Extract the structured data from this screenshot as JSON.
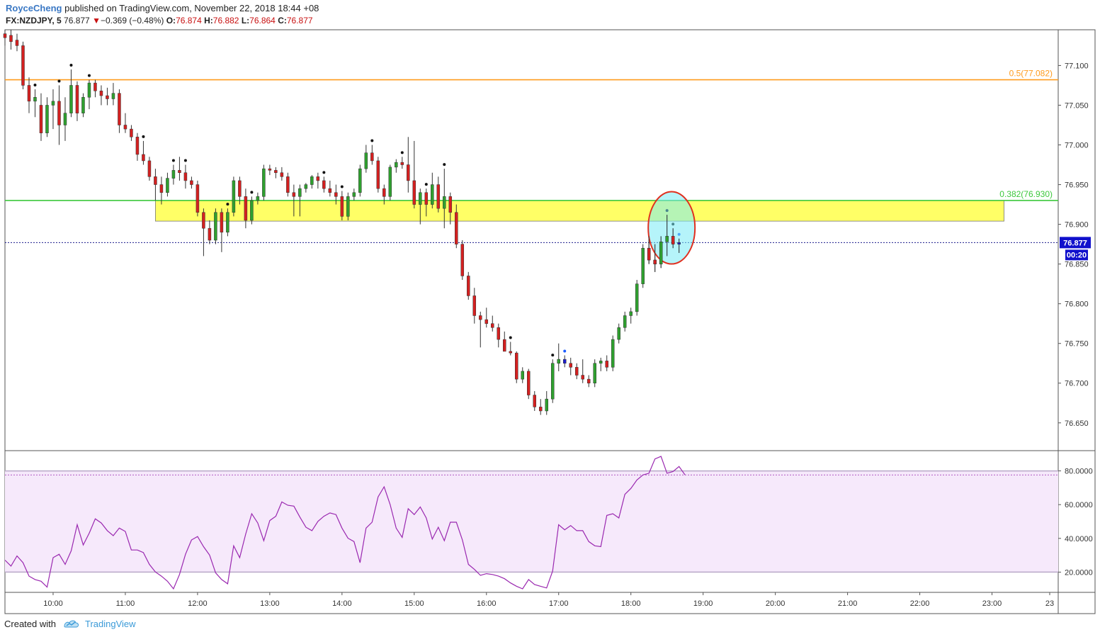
{
  "header": {
    "author": "RoyceCheng",
    "published": "published on TradingView.com, November 22, 2018 18:44 +08",
    "symbol": "FX:NZDJPY, 5",
    "last": "76.877",
    "change": "−0.369 (−0.48%)",
    "o_label": "O:",
    "o": "76.874",
    "h_label": "H:",
    "h": "76.882",
    "l_label": "L:",
    "l": "76.864",
    "c_label": "C:",
    "c": "76.877"
  },
  "footer": {
    "created": "Created with",
    "brand": "TradingView"
  },
  "colors": {
    "up": "#2fa02f",
    "down": "#d42020",
    "mark": "#1c1ccc",
    "fib50": "#ff9b1c",
    "fib382": "#3cc83c",
    "zone": "#ffff66",
    "rsi": "#9a28b0",
    "rsi_band": "#f6e9fb",
    "price_tag": "#1010cc"
  },
  "chart_data": [
    {
      "type": "candlestick",
      "symbol": "FX:NZDJPY",
      "interval": "5",
      "ylim": [
        76.615,
        77.145
      ],
      "xlim": [
        "09:20",
        "23:55"
      ],
      "y_ticks": [
        "77.100",
        "77.050",
        "77.000",
        "76.950",
        "76.900",
        "76.850",
        "76.800",
        "76.750",
        "76.700",
        "76.650"
      ],
      "x_ticks": [
        "10:00",
        "11:00",
        "12:00",
        "13:00",
        "14:00",
        "15:00",
        "16:00",
        "17:00",
        "18:00",
        "19:00",
        "20:00",
        "21:00",
        "22:00",
        "23:00",
        "23"
      ],
      "levels": [
        {
          "label": "0.5(77.082)",
          "value": 77.082,
          "color": "#ff9b1c"
        },
        {
          "label": "0.382(76.930)",
          "value": 76.93,
          "color": "#3cc83c"
        }
      ],
      "zone": {
        "from": 76.904,
        "to": 76.93,
        "start": "11:25",
        "end": "23:10"
      },
      "highlight": {
        "time": "18:35",
        "center": 76.892
      },
      "last_price": {
        "value": 76.877,
        "label": "76.877",
        "countdown": "00:20"
      },
      "candles": [
        [
          77.14,
          77.145,
          77.125,
          77.135
        ],
        [
          77.138,
          77.145,
          77.12,
          77.13
        ],
        [
          77.132,
          77.14,
          77.118,
          77.125
        ],
        [
          77.125,
          77.13,
          77.07,
          77.075
        ],
        [
          77.075,
          77.085,
          77.04,
          77.055
        ],
        [
          77.055,
          77.07,
          77.035,
          77.06
        ],
        [
          77.05,
          77.065,
          77.005,
          77.015
        ],
        [
          77.015,
          77.06,
          77.01,
          77.05
        ],
        [
          77.05,
          77.07,
          77.02,
          77.055
        ],
        [
          77.055,
          77.075,
          77.0,
          77.025
        ],
        [
          77.025,
          77.06,
          77.005,
          77.04
        ],
        [
          77.04,
          77.095,
          77.035,
          77.075
        ],
        [
          77.075,
          77.08,
          77.03,
          77.04
        ],
        [
          77.04,
          77.065,
          77.035,
          77.06
        ],
        [
          77.06,
          77.082,
          77.045,
          77.078
        ],
        [
          77.078,
          77.082,
          77.06,
          77.068
        ],
        [
          77.068,
          77.075,
          77.05,
          77.062
        ],
        [
          77.062,
          77.072,
          77.05,
          77.058
        ],
        [
          77.058,
          77.078,
          77.05,
          77.065
        ],
        [
          77.065,
          77.07,
          77.015,
          77.025
        ],
        [
          77.025,
          77.04,
          77.015,
          77.02
        ],
        [
          77.02,
          77.025,
          77.005,
          77.01
        ],
        [
          77.01,
          77.015,
          76.98,
          76.988
        ],
        [
          76.988,
          77.005,
          76.975,
          76.98
        ],
        [
          76.98,
          76.985,
          76.955,
          76.96
        ],
        [
          76.96,
          76.97,
          76.93,
          76.95
        ],
        [
          76.95,
          76.96,
          76.925,
          76.94
        ],
        [
          76.94,
          76.965,
          76.935,
          76.958
        ],
        [
          76.958,
          76.975,
          76.95,
          76.968
        ],
        [
          76.968,
          76.985,
          76.955,
          76.965
        ],
        [
          76.965,
          76.975,
          76.945,
          76.955
        ],
        [
          76.955,
          76.96,
          76.945,
          76.95
        ],
        [
          76.95,
          76.955,
          76.91,
          76.915
        ],
        [
          76.915,
          76.92,
          76.86,
          76.895
        ],
        [
          76.895,
          76.905,
          76.875,
          76.88
        ],
        [
          76.88,
          76.92,
          76.875,
          76.915
        ],
        [
          76.915,
          76.92,
          76.865,
          76.89
        ],
        [
          76.89,
          76.92,
          76.885,
          76.915
        ],
        [
          76.915,
          76.96,
          76.91,
          76.955
        ],
        [
          76.955,
          76.96,
          76.925,
          76.935
        ],
        [
          76.935,
          76.945,
          76.895,
          76.905
        ],
        [
          76.905,
          76.935,
          76.9,
          76.93
        ],
        [
          76.93,
          76.94,
          76.925,
          76.935
        ],
        [
          76.935,
          76.975,
          76.93,
          76.97
        ],
        [
          76.97,
          76.975,
          76.962,
          76.968
        ],
        [
          76.968,
          76.972,
          76.958,
          76.965
        ],
        [
          76.965,
          76.972,
          76.955,
          76.96
        ],
        [
          76.96,
          76.965,
          76.935,
          76.94
        ],
        [
          76.94,
          76.95,
          76.91,
          76.935
        ],
        [
          76.935,
          76.95,
          76.91,
          76.945
        ],
        [
          76.945,
          76.952,
          76.94,
          76.95
        ],
        [
          76.95,
          76.962,
          76.945,
          76.96
        ],
        [
          76.96,
          76.965,
          76.945,
          76.955
        ],
        [
          76.955,
          76.96,
          76.94,
          76.945
        ],
        [
          76.945,
          76.955,
          76.935,
          76.94
        ],
        [
          76.94,
          76.95,
          76.925,
          76.935
        ],
        [
          76.935,
          76.942,
          76.905,
          76.91
        ],
        [
          76.91,
          76.94,
          76.905,
          76.935
        ],
        [
          76.935,
          76.945,
          76.93,
          76.94
        ],
        [
          76.94,
          76.975,
          76.935,
          76.97
        ],
        [
          76.97,
          77.0,
          76.965,
          76.99
        ],
        [
          76.99,
          77.0,
          76.975,
          76.98
        ],
        [
          76.98,
          76.985,
          76.94,
          76.945
        ],
        [
          76.945,
          76.95,
          76.925,
          76.935
        ],
        [
          76.935,
          76.975,
          76.93,
          76.972
        ],
        [
          76.972,
          76.982,
          76.965,
          76.978
        ],
        [
          76.978,
          76.985,
          76.97,
          76.975
        ],
        [
          76.975,
          77.01,
          76.94,
          76.955
        ],
        [
          76.955,
          77.005,
          76.92,
          76.925
        ],
        [
          76.925,
          76.945,
          76.9,
          76.94
        ],
        [
          76.94,
          76.945,
          76.91,
          76.925
        ],
        [
          76.925,
          76.965,
          76.92,
          76.95
        ],
        [
          76.95,
          76.96,
          76.915,
          76.92
        ],
        [
          76.92,
          76.97,
          76.895,
          76.935
        ],
        [
          76.935,
          76.94,
          76.9,
          76.915
        ],
        [
          76.915,
          76.925,
          76.87,
          76.875
        ],
        [
          76.875,
          76.88,
          76.83,
          76.835
        ],
        [
          76.835,
          76.84,
          76.805,
          76.81
        ],
        [
          76.81,
          76.82,
          76.775,
          76.785
        ],
        [
          76.785,
          76.79,
          76.745,
          76.78
        ],
        [
          76.78,
          76.795,
          76.77,
          76.775
        ],
        [
          76.775,
          76.785,
          76.765,
          76.77
        ],
        [
          76.77,
          76.775,
          76.745,
          76.755
        ],
        [
          76.755,
          76.765,
          76.745,
          76.74
        ],
        [
          76.74,
          76.752,
          76.735,
          76.738
        ],
        [
          76.738,
          76.74,
          76.7,
          76.705
        ],
        [
          76.705,
          76.72,
          76.7,
          76.715
        ],
        [
          76.715,
          76.718,
          76.68,
          76.685
        ],
        [
          76.685,
          76.69,
          76.665,
          76.67
        ],
        [
          76.67,
          76.68,
          76.66,
          76.665
        ],
        [
          76.665,
          76.69,
          76.66,
          76.68
        ],
        [
          76.68,
          76.73,
          76.675,
          76.725
        ],
        [
          76.725,
          76.75,
          76.715,
          76.73
        ],
        [
          76.73,
          76.735,
          76.72,
          76.725
        ],
        [
          76.725,
          76.732,
          76.71,
          76.72
        ],
        [
          76.72,
          76.725,
          76.705,
          76.71
        ],
        [
          76.71,
          76.73,
          76.7,
          76.705
        ],
        [
          76.705,
          76.71,
          76.695,
          76.7
        ],
        [
          76.7,
          76.73,
          76.695,
          76.725
        ],
        [
          76.725,
          76.732,
          76.715,
          76.728
        ],
        [
          76.728,
          76.735,
          76.715,
          76.72
        ],
        [
          76.72,
          76.76,
          76.715,
          76.755
        ],
        [
          76.755,
          76.775,
          76.75,
          76.77
        ],
        [
          76.77,
          76.79,
          76.765,
          76.785
        ],
        [
          76.785,
          76.795,
          76.775,
          76.79
        ],
        [
          76.79,
          76.83,
          76.785,
          76.825
        ],
        [
          76.825,
          76.875,
          76.82,
          76.87
        ],
        [
          76.87,
          76.885,
          76.85,
          76.855
        ],
        [
          76.855,
          76.875,
          76.84,
          76.85
        ],
        [
          76.85,
          76.885,
          76.845,
          76.878
        ],
        [
          76.878,
          76.912,
          76.86,
          76.885
        ],
        [
          76.885,
          76.895,
          76.87,
          76.875
        ],
        [
          76.875,
          76.882,
          76.864,
          76.877
        ]
      ],
      "markers": [
        [
          5,
          "black"
        ],
        [
          9,
          "black"
        ],
        [
          11,
          "black"
        ],
        [
          14,
          "black"
        ],
        [
          23,
          "black"
        ],
        [
          28,
          "black"
        ],
        [
          30,
          "black"
        ],
        [
          37,
          "black"
        ],
        [
          41,
          "black"
        ],
        [
          53,
          "black"
        ],
        [
          56,
          "black"
        ],
        [
          61,
          "black"
        ],
        [
          66,
          "black"
        ],
        [
          70,
          "black"
        ],
        [
          73,
          "black"
        ],
        [
          84,
          "black"
        ],
        [
          91,
          "black"
        ],
        [
          93,
          "blue"
        ],
        [
          110,
          "black"
        ],
        [
          111,
          "black"
        ],
        [
          112,
          "blue"
        ]
      ]
    },
    {
      "type": "line",
      "name": "RSI",
      "ylim": [
        8,
        92
      ],
      "y_ticks": [
        "80.0000",
        "60.0000",
        "40.0000",
        "20.0000"
      ],
      "levels": [
        80,
        20
      ],
      "values": [
        27.1,
        23.6,
        29.6,
        25.6,
        17.6,
        15.6,
        14.6,
        11.1,
        28.6,
        30.6,
        24.6,
        32.6,
        48.1,
        36.1,
        43.1,
        51.6,
        49.1,
        44.6,
        41.6,
        46.1,
        44.1,
        33.1,
        33.1,
        31.6,
        24.6,
        20.1,
        17.6,
        14.6,
        10.1,
        18.6,
        30.6,
        39.1,
        41.1,
        35.1,
        30.1,
        19.6,
        15.6,
        13.1,
        35.6,
        28.6,
        42.6,
        54.6,
        49.1,
        38.6,
        50.6,
        53.1,
        61.6,
        59.6,
        59.1,
        52.6,
        46.6,
        44.6,
        50.1,
        53.1,
        55.1,
        54.1,
        46.1,
        40.1,
        38.1,
        25.6,
        46.1,
        49.6,
        64.6,
        70.6,
        60.1,
        46.1,
        40.6,
        57.6,
        54.1,
        58.6,
        52.1,
        39.6,
        46.6,
        38.6,
        49.6,
        49.6,
        39.1,
        24.6,
        21.6,
        18.1,
        19.1,
        18.6,
        17.6,
        16.1,
        13.6,
        11.6,
        10.1,
        15.6,
        12.6,
        11.6,
        10.6,
        20.6,
        48.1,
        45.1,
        47.6,
        44.6,
        44.6,
        38.1,
        35.6,
        35.1,
        53.6,
        54.6,
        52.1,
        66.1,
        69.6,
        74.6,
        77.6,
        78.6,
        87.1,
        88.6,
        78.6,
        79.6,
        82.6,
        77.6
      ]
    }
  ]
}
